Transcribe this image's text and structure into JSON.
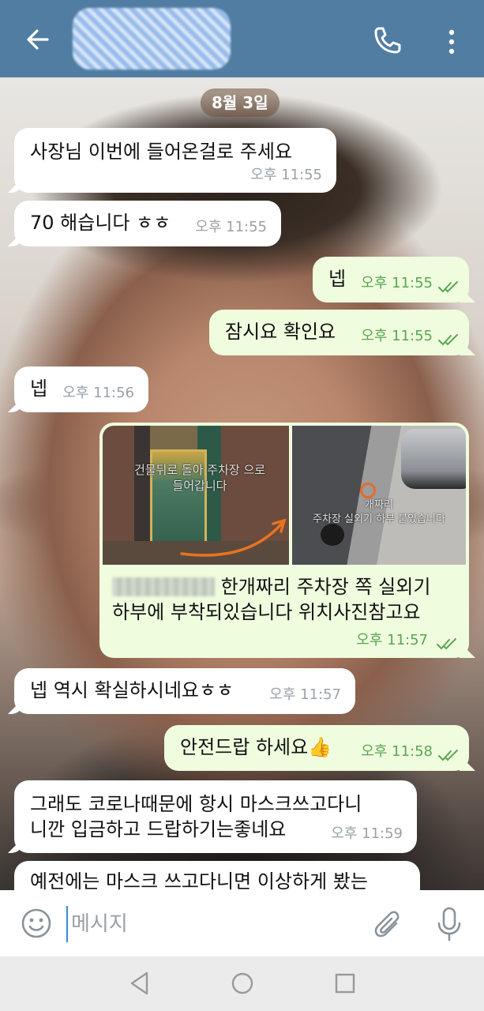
{
  "header": {
    "contact_name": "",
    "back_icon": "arrow-left-icon",
    "call_icon": "phone-icon",
    "menu_icon": "vertical-dots-icon",
    "bg_color": "#517da2"
  },
  "date_label": "8월 3일",
  "messages": [
    {
      "dir": "in",
      "text": "사장님 이번에 들어온걸로 주세요",
      "time": "오후 11:55"
    },
    {
      "dir": "in",
      "text": "70 해습니다 ㅎㅎ",
      "time": "오후 11:55"
    },
    {
      "dir": "out",
      "text": "넵",
      "time": "오후 11:55"
    },
    {
      "dir": "out",
      "text": "잠시요 확인요",
      "time": "오후 11:55"
    },
    {
      "dir": "in",
      "text": "넵",
      "time": "오후 11:56"
    },
    {
      "dir": "out",
      "type": "photo",
      "photo1_caption": "건물뒤로 돌아 주차장 으로\n들어갑니다",
      "photo2_caption": "개짜리\n주차장 실외기 하부 붙였습니다",
      "caption_text": "한개짜리 주차장 쪽 실외기 하부에 부착되있습니다 위치사진참고요",
      "time": "오후 11:57"
    },
    {
      "dir": "in",
      "text": "넵 역시 확실하시네요ㅎㅎ",
      "time": "오후 11:57"
    },
    {
      "dir": "out",
      "text": "안전드랍 하세요👍",
      "time": "오후 11:58"
    },
    {
      "dir": "in",
      "text": "그래도 코로나때문에 항시 마스크쓰고다니\n니깐 입금하고 드랍하기는좋네요",
      "time": "오후 11:59"
    },
    {
      "dir": "in",
      "text": "예전에는 마스크 쓰고다니면 이상하게 봤는",
      "time": ""
    }
  ],
  "input": {
    "placeholder": "메시지",
    "value": "",
    "emoji_icon": "smiley-icon",
    "attach_icon": "paperclip-icon",
    "mic_icon": "microphone-icon"
  },
  "navbar": {
    "back_icon": "triangle-back-icon",
    "home_icon": "circle-home-icon",
    "recent_icon": "square-recents-icon"
  },
  "colors": {
    "outgoing_bubble": "#effdde",
    "incoming_bubble": "#ffffff",
    "outgoing_time": "#5aa554",
    "incoming_time": "#9aa1a8"
  }
}
